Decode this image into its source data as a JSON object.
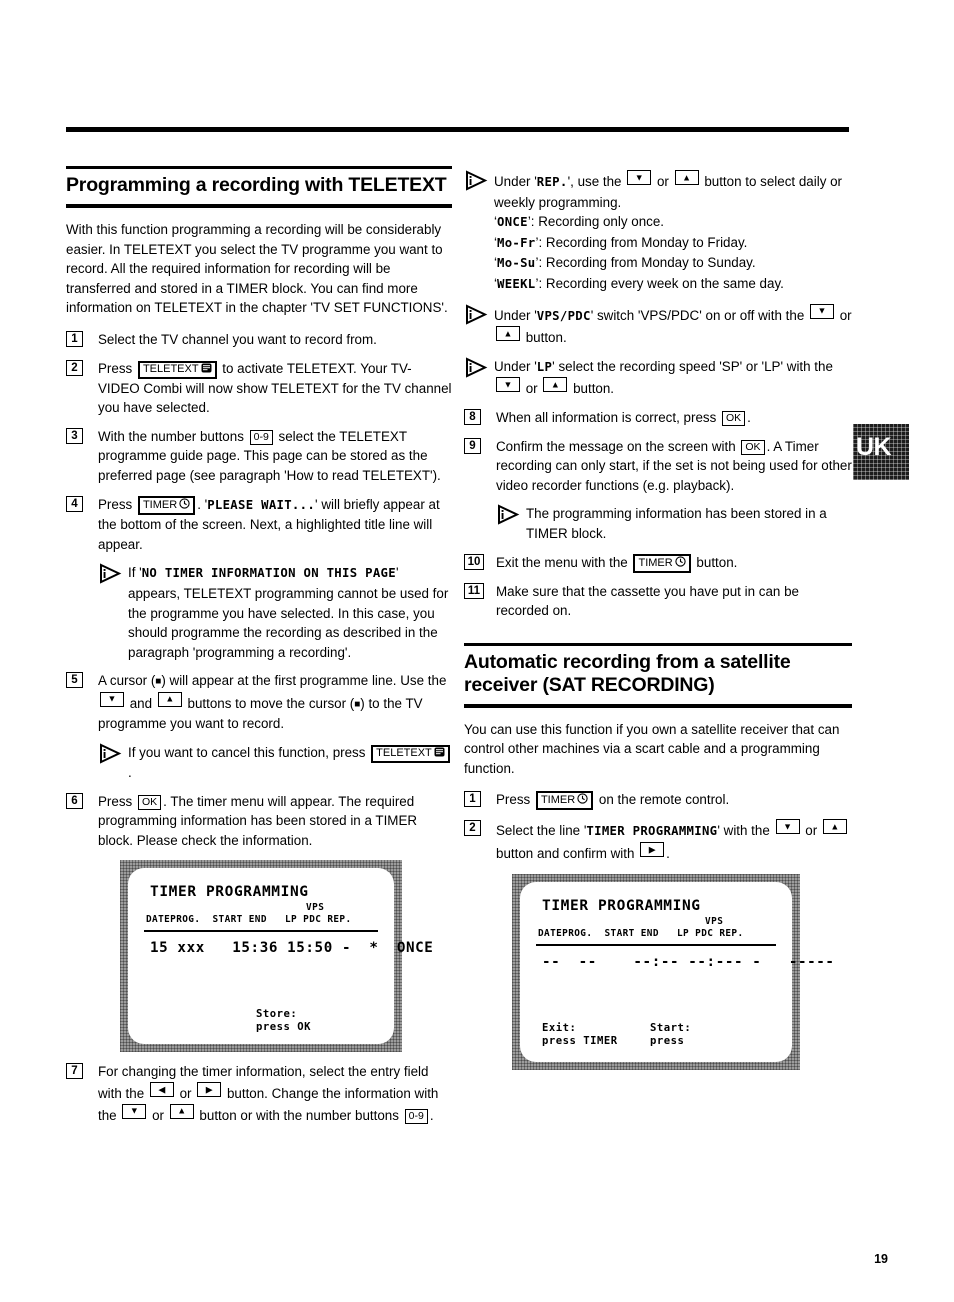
{
  "page": {
    "number": "19",
    "locale_badge": "UK"
  },
  "left_column": {
    "heading": "Programming a recording with TELETEXT",
    "intro": "With this function programming a recording will be considerably easier. In TELETEXT you select the TV programme you want to record. All the required information for recording will be transferred and stored in a TIMER block. You can find more information on TELETEXT in the chapter 'TV SET FUNCTIONS'.",
    "steps": [
      {
        "num": "1",
        "parts": [
          {
            "t": "text",
            "v": "Select the TV channel you want to record from."
          }
        ]
      },
      {
        "num": "2",
        "parts": [
          {
            "t": "text",
            "v": "Press "
          },
          {
            "t": "key",
            "v": "TELETEXT",
            "icon": "teletext-icon"
          },
          {
            "t": "text",
            "v": " to activate TELETEXT. Your TV-VIDEO Combi will now show TELETEXT for the TV channel you have selected."
          }
        ]
      },
      {
        "num": "3",
        "parts": [
          {
            "t": "text",
            "v": "With the number buttons "
          },
          {
            "t": "key",
            "v": "0-9"
          },
          {
            "t": "text",
            "v": " select the TELETEXT programme guide page. This page can be stored as the preferred page (see paragraph 'How to read TELETEXT')."
          }
        ]
      },
      {
        "num": "4",
        "parts": [
          {
            "t": "text",
            "v": "Press "
          },
          {
            "t": "key",
            "v": "TIMER",
            "icon": "clock-icon"
          },
          {
            "t": "text",
            "v": ". '"
          },
          {
            "t": "mono",
            "v": "PLEASE WAIT..."
          },
          {
            "t": "text",
            "v": "' will briefly appear at the bottom of the screen. Next, a highlighted title line will appear."
          }
        ]
      },
      {
        "num": "5",
        "parts": [
          {
            "t": "text",
            "v": "A cursor ("
          },
          {
            "t": "sq",
            "v": "■"
          },
          {
            "t": "text",
            "v": ") will appear at the first programme line. Use the "
          },
          {
            "t": "arrow",
            "v": "▼"
          },
          {
            "t": "text",
            "v": " and "
          },
          {
            "t": "arrow",
            "v": "▲"
          },
          {
            "t": "text",
            "v": " buttons to move the cursor ("
          },
          {
            "t": "sq",
            "v": "■"
          },
          {
            "t": "text",
            "v": ") to the TV programme you want to record."
          }
        ]
      },
      {
        "num": "6",
        "parts": [
          {
            "t": "text",
            "v": "Press "
          },
          {
            "t": "key",
            "v": "OK"
          },
          {
            "t": "text",
            "v": ". The timer menu will appear. The required programming information has been stored in a TIMER block. Please check the information."
          }
        ]
      },
      {
        "num": "7",
        "parts": [
          {
            "t": "text",
            "v": "For changing the timer information, select the entry field with the "
          },
          {
            "t": "arrow",
            "v": "◀"
          },
          {
            "t": "text",
            "v": " or "
          },
          {
            "t": "arrow",
            "v": "▶"
          },
          {
            "t": "text",
            "v": " button. Change the information with the "
          },
          {
            "t": "arrow",
            "v": "▼"
          },
          {
            "t": "text",
            "v": " or "
          },
          {
            "t": "arrow",
            "v": "▲"
          },
          {
            "t": "text",
            "v": " button or with the number buttons "
          },
          {
            "t": "key",
            "v": "0-9"
          },
          {
            "t": "text",
            "v": "."
          }
        ]
      }
    ],
    "note_step4": {
      "parts": [
        {
          "t": "text",
          "v": "If '"
        },
        {
          "t": "mono",
          "v": "NO TIMER INFORMATION ON THIS PAGE"
        },
        {
          "t": "text",
          "v": "' appears, TELETEXT programming cannot be used for the programme you have selected. In this case, you should programme the recording as described in the paragraph 'programming a recording'."
        }
      ]
    },
    "note_step5": {
      "parts": [
        {
          "t": "text",
          "v": "If you want to cancel this function, press "
        },
        {
          "t": "key",
          "v": "TELETEXT",
          "icon": "teletext-icon"
        },
        {
          "t": "text",
          "v": "."
        }
      ]
    },
    "screen": {
      "title": "TIMER PROGRAMMING",
      "vps_label": "VPS",
      "columns": "DATEPROG.  START END   LP PDC REP.",
      "row": "15 xxx   15:36 15:50 -  *  ONCE",
      "footer": "Store:\npress OK"
    }
  },
  "right_column": {
    "notes_top": [
      {
        "parts": [
          {
            "t": "text",
            "v": "Under '"
          },
          {
            "t": "mono",
            "v": "REP."
          },
          {
            "t": "text",
            "v": "', use the "
          },
          {
            "t": "arrow",
            "v": "▼"
          },
          {
            "t": "text",
            "v": " or "
          },
          {
            "t": "arrow",
            "v": "▲"
          },
          {
            "t": "text",
            "v": " button to select daily or weekly programming."
          }
        ],
        "sublines": [
          {
            "code": "ONCE",
            "desc": ": Recording only once."
          },
          {
            "code": "Mo-Fr",
            "desc": ": Recording from Monday to Friday."
          },
          {
            "code": "Mo-Su",
            "desc": ": Recording from Monday to Sunday."
          },
          {
            "code": "WEEKL",
            "desc": ": Recording every week on the same day."
          }
        ]
      },
      {
        "parts": [
          {
            "t": "text",
            "v": "Under '"
          },
          {
            "t": "mono",
            "v": "VPS/PDC"
          },
          {
            "t": "text",
            "v": "' switch 'VPS/PDC' on or off with the "
          },
          {
            "t": "arrow",
            "v": "▼"
          },
          {
            "t": "text",
            "v": " or "
          },
          {
            "t": "arrow",
            "v": "▲"
          },
          {
            "t": "text",
            "v": " button."
          }
        ],
        "sublines": []
      },
      {
        "parts": [
          {
            "t": "text",
            "v": "Under '"
          },
          {
            "t": "mono",
            "v": "LP"
          },
          {
            "t": "text",
            "v": "' select the recording speed 'SP' or 'LP' with the "
          },
          {
            "t": "arrow",
            "v": "▼"
          },
          {
            "t": "text",
            "v": " or "
          },
          {
            "t": "arrow",
            "v": "▲"
          },
          {
            "t": "text",
            "v": " button."
          }
        ],
        "sublines": []
      }
    ],
    "steps": [
      {
        "num": "8",
        "parts": [
          {
            "t": "text",
            "v": "When all information is correct, press "
          },
          {
            "t": "key",
            "v": "OK"
          },
          {
            "t": "text",
            "v": "."
          }
        ]
      },
      {
        "num": "9",
        "parts": [
          {
            "t": "text",
            "v": "Confirm the message on the screen with "
          },
          {
            "t": "key",
            "v": "OK"
          },
          {
            "t": "text",
            "v": ". A Timer recording can only start, if the set is not being used for other video recorder functions (e.g. playback)."
          }
        ]
      },
      {
        "num": "10",
        "parts": [
          {
            "t": "text",
            "v": "Exit the menu with the "
          },
          {
            "t": "key",
            "v": "TIMER",
            "icon": "clock-icon"
          },
          {
            "t": "text",
            "v": " button."
          }
        ]
      },
      {
        "num": "11",
        "parts": [
          {
            "t": "text",
            "v": "Make sure that the cassette you have put in can be recorded on."
          }
        ]
      }
    ],
    "note_step9": {
      "parts": [
        {
          "t": "text",
          "v": "The programming information has been stored in a TIMER block."
        }
      ]
    },
    "heading2": "Automatic recording from a satellite receiver (SAT RECORDING)",
    "intro2": "You can use this function if you own a satellite receiver that can control other machines via a scart cable and a programming function.",
    "sat_steps": [
      {
        "num": "1",
        "parts": [
          {
            "t": "text",
            "v": "Press "
          },
          {
            "t": "key",
            "v": "TIMER",
            "icon": "clock-icon"
          },
          {
            "t": "text",
            "v": " on the remote control."
          }
        ]
      },
      {
        "num": "2",
        "parts": [
          {
            "t": "text",
            "v": "Select the line '"
          },
          {
            "t": "mono",
            "v": "TIMER PROGRAMMING"
          },
          {
            "t": "text",
            "v": "' with the "
          },
          {
            "t": "arrow",
            "v": "▼"
          },
          {
            "t": "text",
            "v": " or "
          },
          {
            "t": "arrow",
            "v": "▲"
          },
          {
            "t": "text",
            "v": " button and confirm with "
          },
          {
            "t": "arrow",
            "v": "▶"
          },
          {
            "t": "text",
            "v": "."
          }
        ]
      }
    ],
    "screen": {
      "title": "TIMER PROGRAMMING",
      "vps_label": "VPS",
      "columns": "DATEPROG.  START END   LP PDC REP.",
      "row": "--  --    --:-- --:--- -   -----",
      "footer_left": "Exit:\npress TIMER",
      "footer_right": "Start:\npress"
    }
  }
}
